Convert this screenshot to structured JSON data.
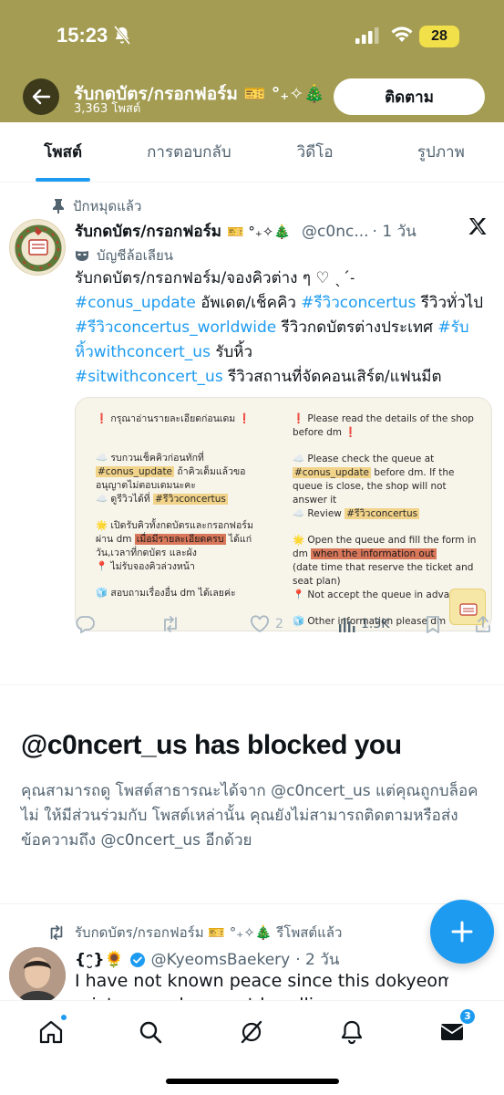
{
  "status_bar": {
    "time": "15:23",
    "battery": "28"
  },
  "header": {
    "title": "รับกดบัตร/กรอกฟอร์ม 🎫 °₊✧🎄",
    "post_count": "3,363 โพสต์",
    "follow_label": "ติดตาม"
  },
  "tabs": [
    {
      "label": "โพสต์",
      "active": true
    },
    {
      "label": "การตอบกลับ",
      "active": false
    },
    {
      "label": "วิดีโอ",
      "active": false
    },
    {
      "label": "รูปภาพ",
      "active": false
    }
  ],
  "pinned_post": {
    "pinned_label": "ปักหมุดแล้ว",
    "author": "รับกดบัตร/กรอกฟอร์ม",
    "author_emoji": "🎫 °₊✧🎄",
    "handle": "@c0nc...",
    "time": "· 1 วัน",
    "parody_label": "บัญชีล้อเลียน",
    "text_line1": "รับกดบัตร/กรอกฟอร์ม/จองคิวต่าง ๆ ♡ ˎˊ˗",
    "hashtag_update": "#conus_update",
    "text_update": " อัพเดต/เช็คคิว ",
    "hashtag_review": "#รีวิวconcertus",
    "text_review": " รีวิวทั่วไป ",
    "hashtag_worldwide": "#รีวิวconcertus_worldwide",
    "text_worldwide": " รีวิวกดบัตรต่างประเทศ ",
    "hashtag_with": "#รับหิ้วwithconcert_us",
    "text_with": " รับหิ้ว",
    "hashtag_sit": "#sitwithconcert_us",
    "text_sit": " รีวิวสถานที่จัดคอนเสิร์ต/แฟนมีต",
    "media": {
      "th_heading": "❗ กรุณาอ่านรายละเอียดก่อนเดม ❗",
      "th_1a": "☁️ รบกวนเช็คคิวก่อนทักที่",
      "th_1b_hl": "#conus_update",
      "th_1b": " ถ้าคิวเต็มแล้วขอ",
      "th_1c": "อนุญาตไม่ตอบเดมนะคะ",
      "th_2a": "☁️ ดูรีวิวได้ที่ ",
      "th_2a_hl": "#รีวิวconcertus",
      "th_3a": "🌟 เปิดรับคิวทั้งกดบัตรและกรอกฟอร์ม",
      "th_3b": "ผ่าน dm ",
      "th_3b_hl": "เมื่อมีรายละเอียดครบ",
      "th_3b2": " ได้แก่",
      "th_3c": "วัน,เวลาที่กดบัตร และผัง",
      "th_3d": "📍 ไม่รับจองคิวล่วงหน้า",
      "th_4": "🧊 สอบถามเรื่องอื่น dm ได้เลยค่ะ",
      "en_heading": "❗ Please read the details of the shop before dm ❗",
      "en_1a": "☁️ Please check the queue at",
      "en_1b_hl": "#conus_update",
      "en_1b": " before dm. If the",
      "en_1c": "queue is close, the shop will not",
      "en_1d": "answer it",
      "en_2a": "☁️ Review ",
      "en_2a_hl": "#รีวิวconcertus",
      "en_3a": "🌟 Open the queue and fill the form in",
      "en_3b": "dm ",
      "en_3b_hl": "when the information out",
      "en_3c": "(date time that reserve the ticket and",
      "en_3d": "seat plan)",
      "en_3e": "📍 Not accept the queue in advance",
      "en_4": "🧊 Other information please dm",
      "stamp_text": "CONCERT US"
    },
    "likes": "2",
    "views": "1.3K"
  },
  "blocked": {
    "title": "@c0ncert_us has blocked you",
    "description": "คุณสามารถดู โพสต์สาธารณะได้จาก @c0ncert_us แต่คุณถูกบล็อคไม่ ให้มีส่วนร่วมกับ โพสต์เหล่านั้น คุณยังไม่สามารถติดตามหรือส่งข้อความถึง @c0ncert_us อีกด้วย"
  },
  "repost": {
    "reposted_label": "รับกดบัตร/กรอกฟอร์ม 🎫 °₊✧🎄 รีโพสต์แล้ว",
    "name": "{ᵔ̮}🌻",
    "handle": "@KyeomsBaekery",
    "time": "· 2 วัน",
    "text": "I have not known peace since this dokyeom,",
    "text2": "mixtape and concert bundling"
  },
  "bottom_nav": {
    "messages_badge": "3"
  },
  "colors": {
    "header_bg": "#a39c52",
    "accent": "#1d9bf0",
    "muted": "#536471"
  }
}
